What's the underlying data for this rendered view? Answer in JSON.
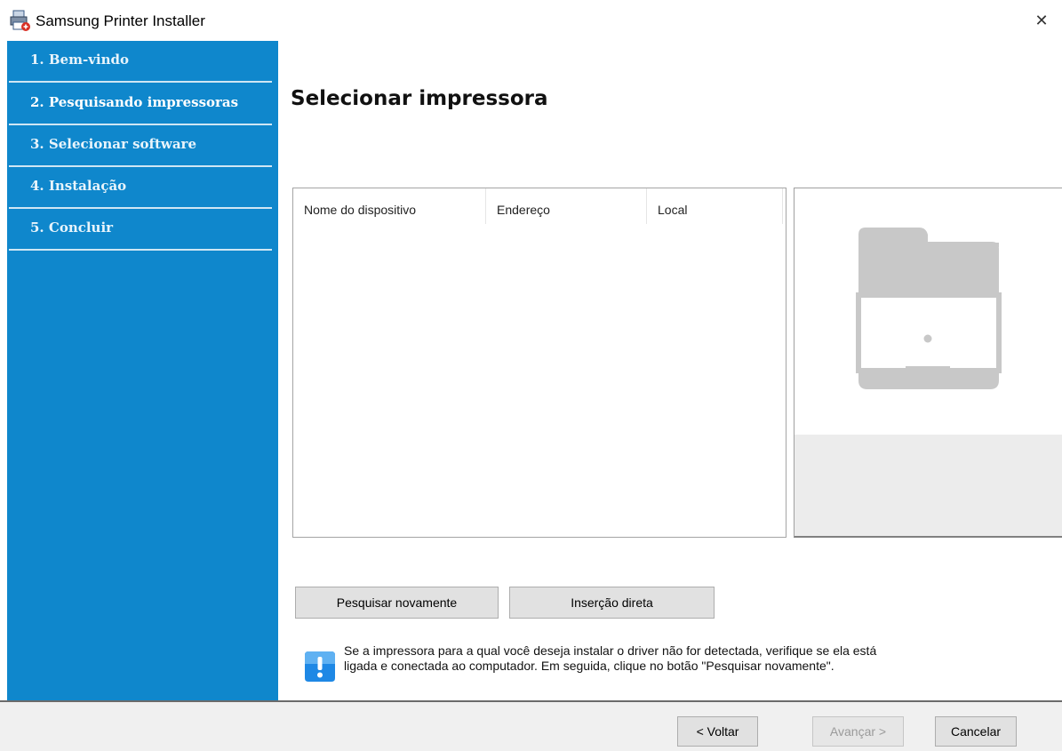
{
  "window": {
    "title": "Samsung Printer Installer",
    "close_glyph": "✕"
  },
  "sidebar": {
    "steps": [
      {
        "label": "1. Bem-vindo"
      },
      {
        "label": "2. Pesquisando impressoras"
      },
      {
        "label": "3. Selecionar software"
      },
      {
        "label": "4. Instalação"
      },
      {
        "label": "5. Concluir"
      }
    ],
    "active_index": 1
  },
  "main": {
    "title": "Selecionar impressora",
    "table": {
      "columns": [
        "Nome do dispositivo",
        "Endereço",
        "Local"
      ],
      "rows": []
    },
    "buttons": {
      "search_again": "Pesquisar novamente",
      "direct_entry": "Inserção direta"
    },
    "info": {
      "line1": "Se a impressora para a qual você deseja instalar o driver não for detectada, verifique se ela está",
      "line2": "ligada e conectada ao computador. Em seguida, clique no botão \"Pesquisar novamente\"."
    }
  },
  "footer": {
    "back": "< Voltar",
    "next": "Avançar >",
    "cancel": "Cancelar"
  },
  "colors": {
    "sidebar": "#0f87cc",
    "accent_info": "#1e88e5"
  }
}
